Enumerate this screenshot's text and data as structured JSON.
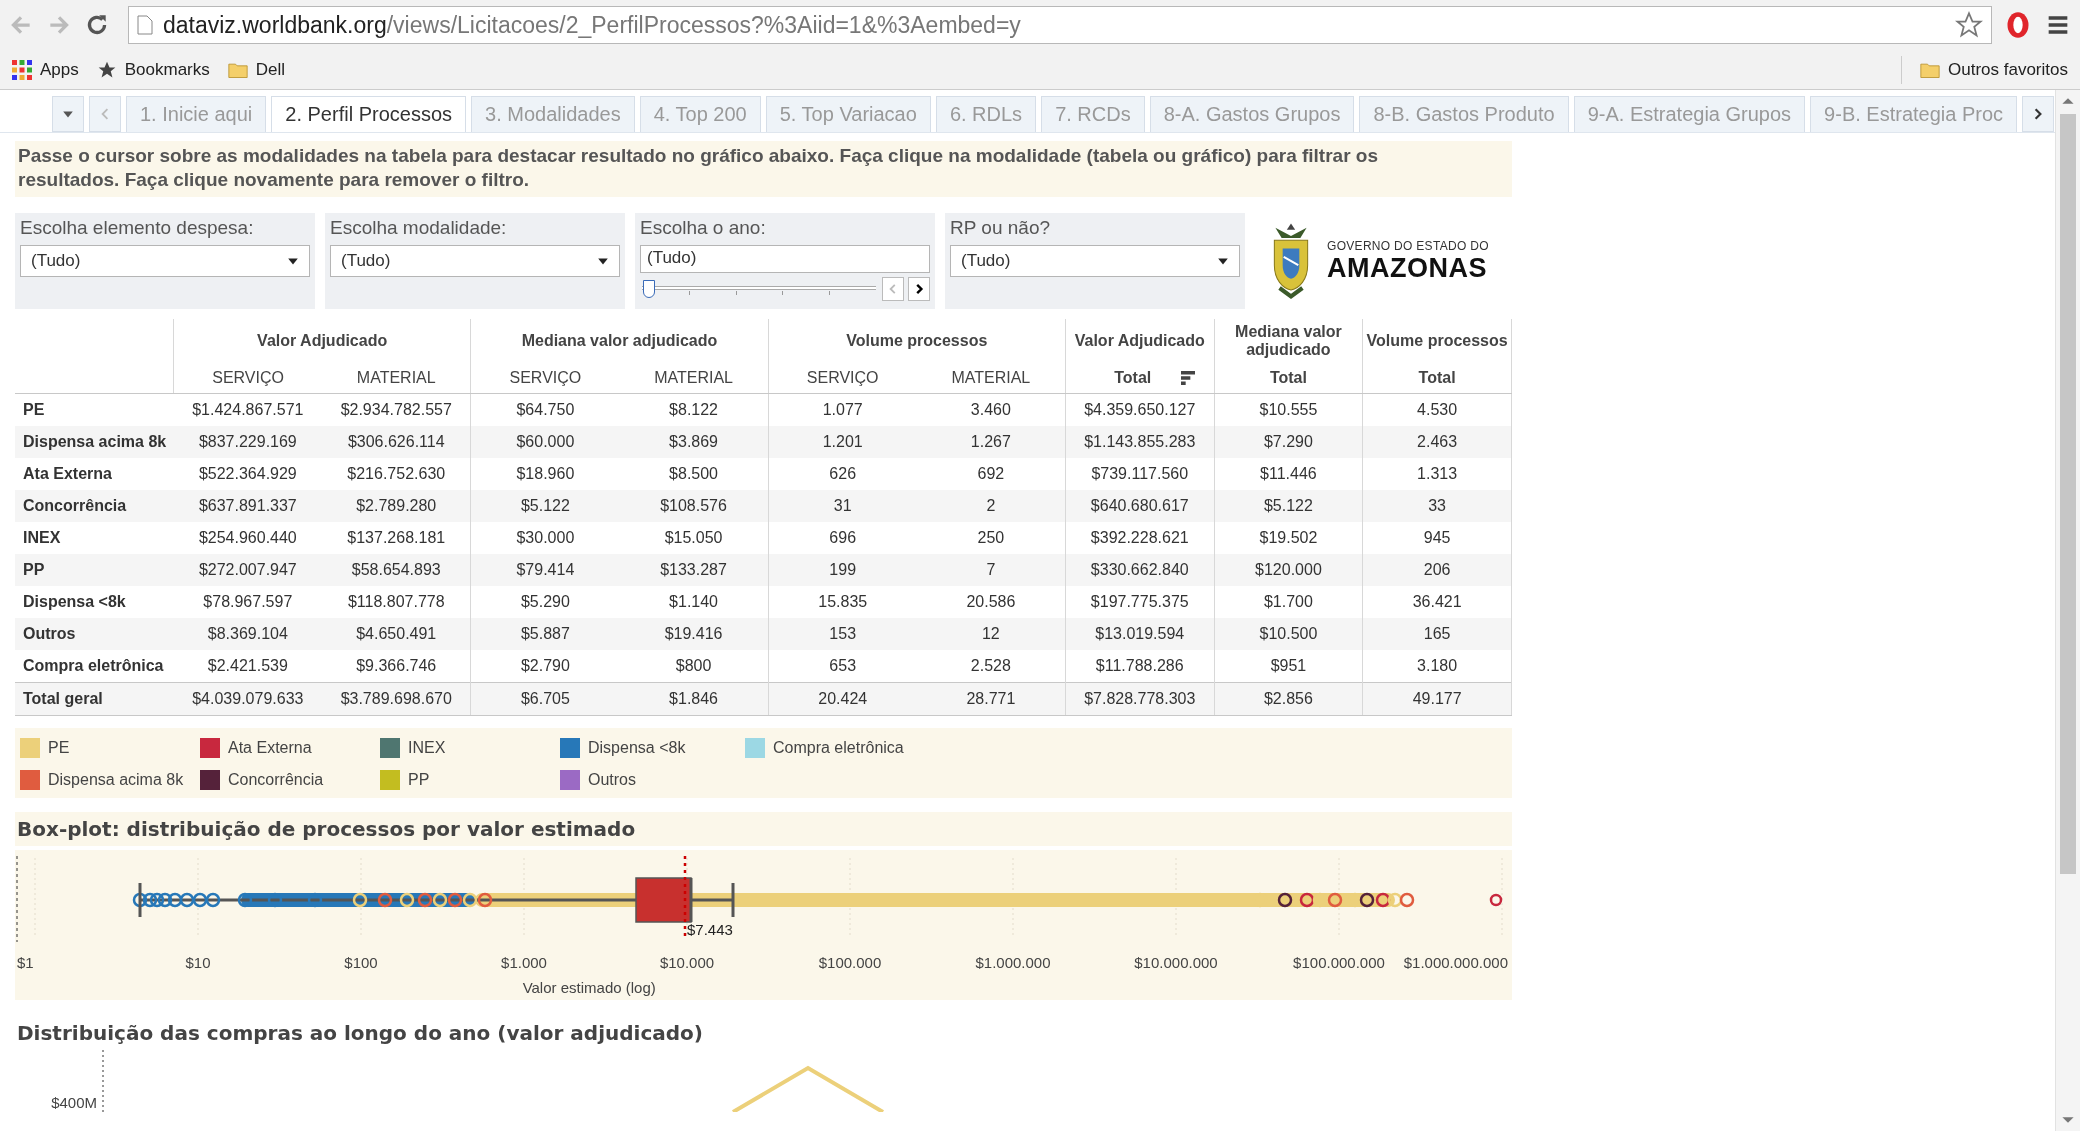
{
  "browser": {
    "url": {
      "host": "dataviz.worldbank.org",
      "path": "/views/Licitacoes/2_PerfilProcessos?%3Aiid=1&%3Aembed=y"
    },
    "bookmarks": [
      {
        "label": "Apps",
        "kind": "apps"
      },
      {
        "label": "Bookmarks",
        "kind": "star"
      },
      {
        "label": "Dell",
        "kind": "folder"
      }
    ],
    "other_bookmarks": {
      "label": "Outros favoritos"
    }
  },
  "tabs": [
    {
      "label": "1. Inicie aqui",
      "selected": false
    },
    {
      "label": "2. Perfil Processos",
      "selected": true
    },
    {
      "label": "3. Modalidades",
      "selected": false
    },
    {
      "label": "4. Top 200",
      "selected": false
    },
    {
      "label": "5. Top Variacao",
      "selected": false
    },
    {
      "label": "6. RDLs",
      "selected": false
    },
    {
      "label": "7. RCDs",
      "selected": false
    },
    {
      "label": "8-A. Gastos Grupos",
      "selected": false
    },
    {
      "label": "8-B. Gastos Produto",
      "selected": false
    },
    {
      "label": "9-A. Estrategia Grupos",
      "selected": false
    },
    {
      "label": "9-B. Estrategia Proc",
      "selected": false
    }
  ],
  "instructions": "Passe o cursor sobre as modalidades na tabela para destacar resultado no gráfico abaixo. Faça clique na modalidade (tabela ou gráfico) para filtrar os resultados. Faça clique novamente para remover o filtro.",
  "filters": [
    {
      "kind": "dropdown",
      "label": "Escolha elemento despesa:",
      "value": "(Tudo)"
    },
    {
      "kind": "dropdown",
      "label": "Escolha modalidade:",
      "value": "(Tudo)"
    },
    {
      "kind": "slider",
      "label": "Escolha o ano:",
      "value": "(Tudo)",
      "level": 0
    },
    {
      "kind": "dropdown",
      "label": "RP ou não?",
      "value": "(Tudo)"
    }
  ],
  "logo": {
    "line1": "GOVERNO DO ESTADO DO",
    "line2": "AMAZONAS"
  },
  "table": {
    "column_groups": [
      {
        "label": "Valor Adjudicado",
        "columns": [
          {
            "label": "SERVIÇO",
            "sorted": false
          },
          {
            "label": "MATERIAL",
            "sorted": false
          }
        ]
      },
      {
        "label": "Mediana valor adjudicado",
        "columns": [
          {
            "label": "SERVIÇO",
            "sorted": false
          },
          {
            "label": "MATERIAL",
            "sorted": false
          }
        ]
      },
      {
        "label": "Volume processos",
        "columns": [
          {
            "label": "SERVIÇO",
            "sorted": false
          },
          {
            "label": "MATERIAL",
            "sorted": false
          }
        ]
      },
      {
        "label": "Valor Adjudicado",
        "columns": [
          {
            "label": "Total",
            "sorted": true
          }
        ]
      },
      {
        "label": "Mediana valor adjudicado",
        "columns": [
          {
            "label": "Total",
            "sorted": false
          }
        ]
      },
      {
        "label": "Volume processos",
        "columns": [
          {
            "label": "Total",
            "sorted": false
          }
        ]
      }
    ],
    "rows": [
      {
        "kind": "data",
        "name": "PE",
        "values": [
          "$1.424.867.571",
          "$2.934.782.557",
          "$64.750",
          "$8.122",
          "1.077",
          "3.460",
          "$4.359.650.127",
          "$10.555",
          "4.530"
        ]
      },
      {
        "kind": "data",
        "name": "Dispensa acima 8k",
        "values": [
          "$837.229.169",
          "$306.626.114",
          "$60.000",
          "$3.869",
          "1.201",
          "1.267",
          "$1.143.855.283",
          "$7.290",
          "2.463"
        ]
      },
      {
        "kind": "data",
        "name": "Ata Externa",
        "values": [
          "$522.364.929",
          "$216.752.630",
          "$18.960",
          "$8.500",
          "626",
          "692",
          "$739.117.560",
          "$11.446",
          "1.313"
        ]
      },
      {
        "kind": "data",
        "name": "Concorrência",
        "values": [
          "$637.891.337",
          "$2.789.280",
          "$5.122",
          "$108.576",
          "31",
          "2",
          "$640.680.617",
          "$5.122",
          "33"
        ]
      },
      {
        "kind": "data",
        "name": "INEX",
        "values": [
          "$254.960.440",
          "$137.268.181",
          "$30.000",
          "$15.050",
          "696",
          "250",
          "$392.228.621",
          "$19.502",
          "945"
        ]
      },
      {
        "kind": "data",
        "name": "PP",
        "values": [
          "$272.007.947",
          "$58.654.893",
          "$79.414",
          "$133.287",
          "199",
          "7",
          "$330.662.840",
          "$120.000",
          "206"
        ]
      },
      {
        "kind": "data",
        "name": "Dispensa <8k",
        "values": [
          "$78.967.597",
          "$118.807.778",
          "$5.290",
          "$1.140",
          "15.835",
          "20.586",
          "$197.775.375",
          "$1.700",
          "36.421"
        ]
      },
      {
        "kind": "data",
        "name": "Outros",
        "values": [
          "$8.369.104",
          "$4.650.491",
          "$5.887",
          "$19.416",
          "153",
          "12",
          "$13.019.594",
          "$10.500",
          "165"
        ]
      },
      {
        "kind": "data",
        "name": "Compra eletrônica",
        "values": [
          "$2.421.539",
          "$9.366.746",
          "$2.790",
          "$800",
          "653",
          "2.528",
          "$11.788.286",
          "$951",
          "3.180"
        ]
      },
      {
        "kind": "total",
        "name": "Total geral",
        "values": [
          "$4.039.079.633",
          "$3.789.698.670",
          "$6.705",
          "$1.846",
          "20.424",
          "28.771",
          "$7.828.778.303",
          "$2.856",
          "49.177"
        ]
      }
    ]
  },
  "legend": [
    {
      "label": "PE",
      "color": "#ecd07a"
    },
    {
      "label": "Dispensa acima 8k",
      "color": "#e05c3f"
    },
    {
      "label": "Ata Externa",
      "color": "#c8283e"
    },
    {
      "label": "Concorrência",
      "color": "#55223a"
    },
    {
      "label": "INEX",
      "color": "#4f7670"
    },
    {
      "label": "PP",
      "color": "#c3bd20"
    },
    {
      "label": "Dispensa <8k",
      "color": "#2778b8"
    },
    {
      "label": "Outros",
      "color": "#9b6ac4"
    },
    {
      "label": "Compra eletrônica",
      "color": "#9cd8e4"
    }
  ],
  "boxplot": {
    "title": "Box-plot: distribuição de processos por valor estimado",
    "marker_label": "$7.443",
    "xlabel": "Valor estimado (log)",
    "xticks": [
      "$1",
      "$10",
      "$100",
      "$1.000",
      "$10.000",
      "$100.000",
      "$1.000.000",
      "$10.000.000",
      "$100.000.000",
      "$1.000.000.000"
    ]
  },
  "timeline": {
    "title": "Distribuição das compras ao longo do ano (valor adjudicado)",
    "ytick": "$400M"
  }
}
